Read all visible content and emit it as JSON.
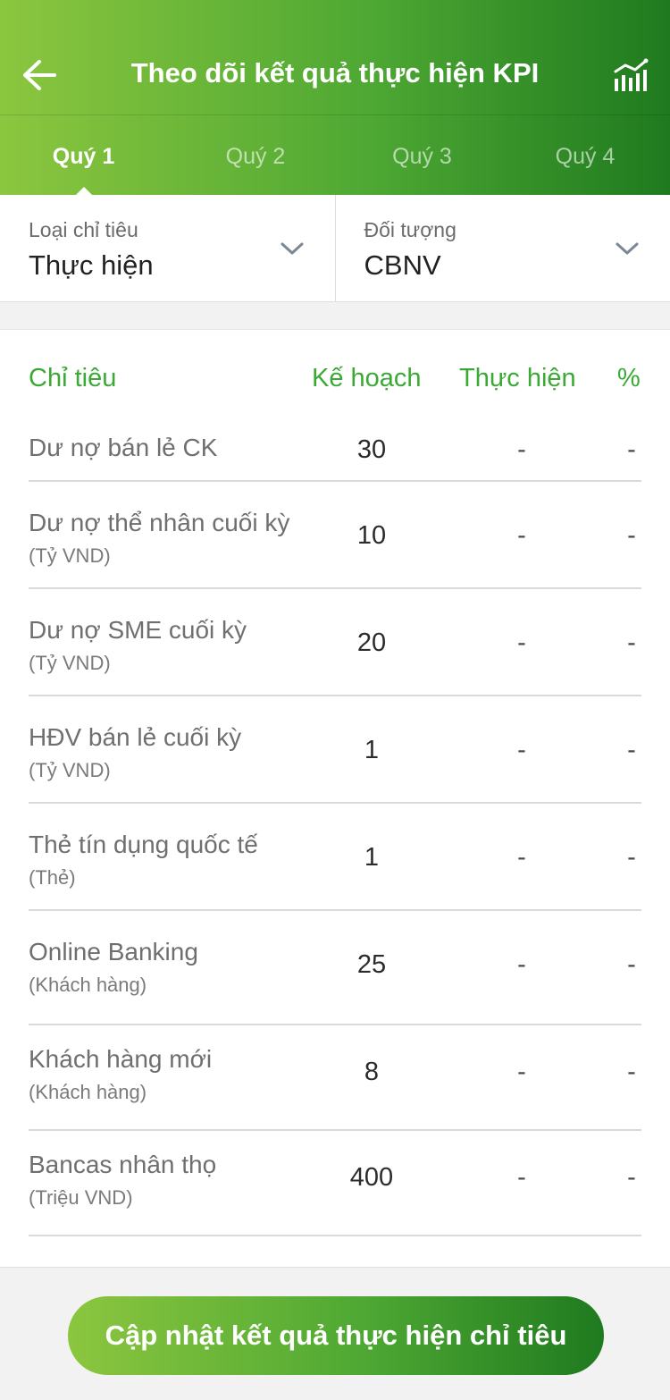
{
  "header": {
    "title": "Theo dõi kết quả thực hiện KPI",
    "back_icon": "arrow-left-icon",
    "chart_icon": "bar-chart-icon"
  },
  "tabs": [
    {
      "label": "Quý 1",
      "active": true
    },
    {
      "label": "Quý 2",
      "active": false
    },
    {
      "label": "Quý 3",
      "active": false
    },
    {
      "label": "Quý 4",
      "active": false
    }
  ],
  "filters": {
    "metric_type": {
      "label": "Loại chỉ tiêu",
      "value": "Thực hiện"
    },
    "target": {
      "label": "Đối tượng",
      "value": "CBNV"
    }
  },
  "table": {
    "headers": {
      "name": "Chỉ tiêu",
      "plan": "Kế hoạch",
      "actual": "Thực hiện",
      "percent": "%"
    },
    "rows": [
      {
        "name": "Dư nợ bán lẻ CK",
        "unit": "",
        "plan": "30",
        "actual": "-",
        "percent": "-"
      },
      {
        "name": "Dư nợ thể nhân cuối kỳ",
        "unit": "(Tỷ VND)",
        "plan": "10",
        "actual": "-",
        "percent": "-"
      },
      {
        "name": "Dư nợ SME cuối kỳ",
        "unit": "(Tỷ VND)",
        "plan": "20",
        "actual": "-",
        "percent": "-"
      },
      {
        "name": "HĐV bán lẻ cuối kỳ",
        "unit": "(Tỷ VND)",
        "plan": "1",
        "actual": "-",
        "percent": "-"
      },
      {
        "name": "Thẻ tín dụng quốc tế",
        "unit": "(Thẻ)",
        "plan": "1",
        "actual": "-",
        "percent": "-"
      },
      {
        "name": "Online Banking",
        "unit": "(Khách hàng)",
        "plan": "25",
        "actual": "-",
        "percent": "-"
      },
      {
        "name": "Khách hàng mới",
        "unit": "(Khách hàng)",
        "plan": "8",
        "actual": "-",
        "percent": "-"
      },
      {
        "name": "Bancas nhân thọ",
        "unit": "(Triệu VND)",
        "plan": "400",
        "actual": "-",
        "percent": "-"
      }
    ]
  },
  "footer": {
    "update_button": "Cập nhật kết quả thực hiện chỉ tiêu"
  },
  "colors": {
    "brand_green_light": "#8cc63f",
    "brand_green_dark": "#1f7a1f",
    "header_text_green": "#3aaa35"
  }
}
